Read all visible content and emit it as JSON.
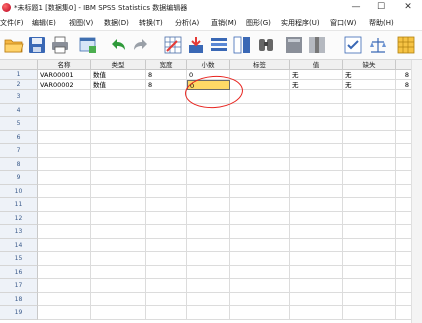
{
  "window": {
    "title": "*未标题1 [数据集0] - IBM SPSS Statistics 数据编辑器",
    "minimize": "—",
    "maximize": "☐",
    "close": "✕"
  },
  "menu": [
    "文件(F)",
    "编辑(E)",
    "视图(V)",
    "数据(D)",
    "转换(T)",
    "分析(A)",
    "直销(M)",
    "图形(G)",
    "实用程序(U)",
    "窗口(W)",
    "帮助(H)"
  ],
  "toolbar": {
    "icons": [
      "open-folder-icon",
      "save-icon",
      "print-icon",
      "dialog-recall-icon",
      "undo-icon",
      "redo-icon",
      "goto-case-icon",
      "goto-variable-icon",
      "variables-icon",
      "split-file-icon",
      "find-icon",
      "insert-cases-icon",
      "insert-variable-icon",
      "select-cases-icon",
      "weight-cases-icon",
      "value-labels-icon"
    ]
  },
  "grid": {
    "columns": [
      "名称",
      "类型",
      "宽度",
      "小数",
      "标签",
      "值",
      "缺失",
      ""
    ],
    "rows": [
      {
        "num": "1",
        "name": "VAR00001",
        "type": "数值",
        "width": "8",
        "decimals": "0",
        "label": "",
        "values": "无",
        "missing": "无",
        "columns": "8"
      },
      {
        "num": "2",
        "name": "VAR00002",
        "type": "数值",
        "width": "8",
        "decimals": "0",
        "label": "",
        "values": "无",
        "missing": "无",
        "columns": "8"
      }
    ],
    "empty_rows": [
      "3",
      "4",
      "5",
      "6",
      "7",
      "8",
      "9",
      "10",
      "11",
      "12",
      "13",
      "14",
      "15",
      "16",
      "17",
      "18",
      "19"
    ]
  }
}
